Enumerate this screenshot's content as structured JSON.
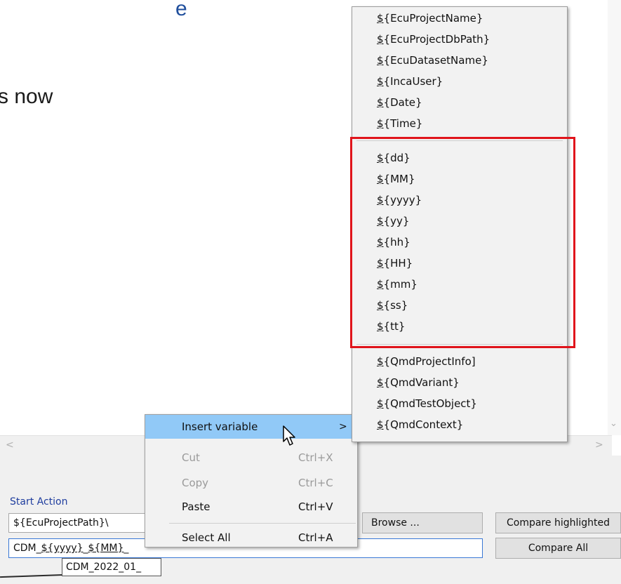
{
  "slide": {
    "partial_top": "e",
    "partial_line": "s now"
  },
  "window": {
    "start_action_label": "Start Action",
    "path_value": "${EcuProjectPath}\\",
    "name_value_a": "CDM_",
    "name_value_b": "${yyyy}",
    "name_value_c": "_",
    "name_value_d": "${MM}",
    "name_value_e": "_",
    "browse_label": "Browse ...",
    "compare_highlighted_label": "Compare highlighted",
    "compare_all_label": "Compare All",
    "tooltip_text": "CDM_2022_01_"
  },
  "context_menu": {
    "insert_variable": "Insert variable",
    "submenu_arrow": ">",
    "cut": "Cut",
    "cut_sc": "Ctrl+X",
    "copy": "Copy",
    "copy_sc": "Ctrl+C",
    "paste": "Paste",
    "paste_sc": "Ctrl+V",
    "select_all": "Select All",
    "select_all_sc": "Ctrl+A"
  },
  "variables_menu": {
    "group1": [
      "${EcuProjectName}",
      "${EcuProjectDbPath}",
      "${EcuDatasetName}",
      "${IncaUser}",
      "${Date}",
      "${Time}"
    ],
    "group2": [
      "${dd}",
      "${MM}",
      "${yyyy}",
      "${yy}",
      "${hh}",
      "${HH}",
      "${mm}",
      "${ss}",
      "${tt}"
    ],
    "group3": [
      "${QmdProjectInfo]",
      "${QmdVariant}",
      "${QmdTestObject}",
      "${QmdContext}"
    ]
  },
  "colors": {
    "highlight": "#91c9f7",
    "red_box": "#e0141b",
    "link_blue": "#1f3d9e"
  }
}
